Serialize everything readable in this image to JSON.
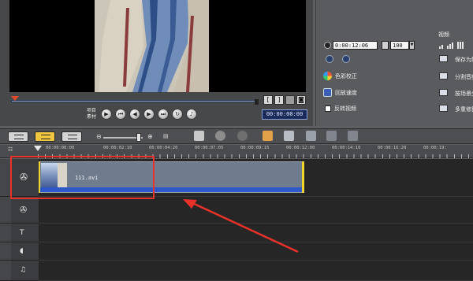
{
  "preview": {
    "mode_labels": [
      "项目",
      "素材"
    ],
    "timecode": "00:00:00:00",
    "trim": {
      "mark_in": "[",
      "mark_out": "]"
    }
  },
  "options": {
    "tab_title": "视频",
    "duration": "0:00:12:06",
    "volume": "100",
    "color_correction": "色彩校正",
    "playback_speed": "回放速度",
    "reverse_video": "反转视频",
    "save_as_still": "保存为静",
    "split_audio": "分割音频",
    "scene_split": "按场景分",
    "multi_trim": "多重修整"
  },
  "timeline": {
    "ruler_labels": [
      "00:00:00:00",
      "00:00:02:10",
      "00:00:04:20",
      "00:00:07:05",
      "00:00:09:15",
      "00:00:12:00",
      "00:00:14:10",
      "00:00:16:20",
      "00:00:19:"
    ],
    "clip": {
      "name": "111.avi"
    }
  },
  "colors": {
    "highlight": "#e8322a",
    "clip_audio": "#2f58c8",
    "timecode_bg": "#1b2c5a"
  },
  "icons": [
    "mark-in-icon",
    "mark-out-icon",
    "fullscreen-icon",
    "play-icon",
    "home-icon",
    "prev-frame-icon",
    "next-frame-icon",
    "end-icon",
    "repeat-icon",
    "volume-icon",
    "clock-icon",
    "rotate-left-icon",
    "rotate-right-icon",
    "color-wheel-icon",
    "speed-icon",
    "save-still-icon",
    "split-audio-icon",
    "scene-split-icon",
    "multi-trim-icon",
    "storyboard-view-icon",
    "timeline-view-icon",
    "audio-view-icon",
    "zoom-out-icon",
    "zoom-in-icon",
    "film-reel-icon",
    "title-icon",
    "music-icon"
  ]
}
